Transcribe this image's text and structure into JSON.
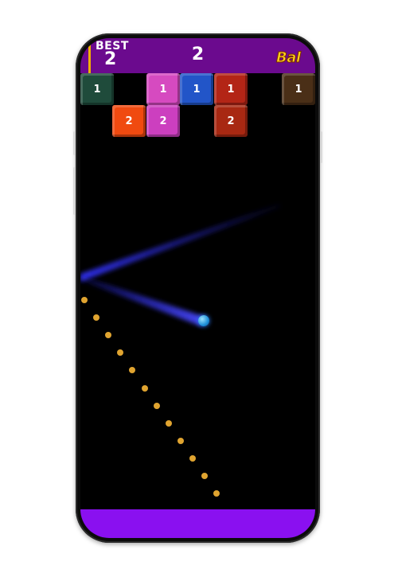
{
  "header": {
    "best_label": "BEST",
    "best_value": "2",
    "score": "2",
    "logo_text": "Bal"
  },
  "bricks": [
    {
      "value": "1",
      "color": "#1f4b3b"
    },
    {
      "value": "1",
      "color": "#d64ac0"
    },
    {
      "value": "1",
      "color": "#2255c8"
    },
    {
      "value": "1",
      "color": "#b32516"
    },
    {
      "value": "1",
      "color": "#4a2f17"
    },
    {
      "value": "2",
      "color": "#f04a10"
    },
    {
      "value": "2",
      "color": "#cc3fbf"
    },
    {
      "value": "2",
      "color": "#a82812"
    }
  ],
  "colors": {
    "topbar": "#6b0a8e",
    "bottombar": "#8a10f0",
    "ball": "#1e8fd8",
    "trail": "#2a2aff",
    "aim_dots": "#e0a430"
  }
}
